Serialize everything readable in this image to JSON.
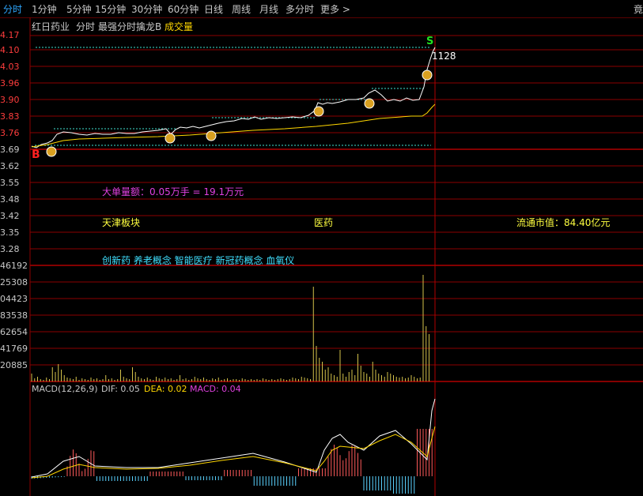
{
  "tabs": [
    {
      "label": "分时",
      "active": true
    },
    {
      "label": "1分钟"
    },
    {
      "label": "5分钟"
    },
    {
      "label": "15分钟"
    },
    {
      "label": "30分钟"
    },
    {
      "label": "60分钟"
    },
    {
      "label": "日线"
    },
    {
      "label": "周线"
    },
    {
      "label": "月线"
    },
    {
      "label": "多分时"
    },
    {
      "label": "更多 >"
    }
  ],
  "corner_label": "竟",
  "header": {
    "stock_name": "红日药业",
    "mode": "分时",
    "indicator": "最强分时擒龙B",
    "volume_label": "成交量"
  },
  "price_axis": {
    "labels": [
      "4.17",
      "4.10",
      "4.03",
      "3.96",
      "3.90",
      "3.83",
      "3.76",
      "3.69",
      "3.62",
      "3.55",
      "3.48",
      "3.42",
      "3.35",
      "3.28"
    ],
    "red_labels": [
      "4.17",
      "4.10",
      "4.03",
      "3.96",
      "3.90",
      "3.83",
      "3.76"
    ]
  },
  "volume_axis": {
    "labels": [
      "46192",
      "25308",
      "04423",
      "83538",
      "62654",
      "41769",
      "20885"
    ]
  },
  "markers": {
    "buy_label": "B",
    "sell_label": "S",
    "peak_label": "1128"
  },
  "info": {
    "big_order": "大单量额：0.05万手 = 19.1万元",
    "sector": "天津板块",
    "industry": "医药",
    "float_cap": "流通市值：84.40亿元",
    "concepts": "创新药 养老概念 智能医疗 新冠药概念 血氧仪"
  },
  "macd": {
    "label": "MACD(12,26,9)",
    "dif": "DIF: 0.05",
    "dea": "DEA: 0.02",
    "macd": "MACD: 0.04"
  },
  "colors": {
    "background": "#000000",
    "grid": "#8b0000",
    "price_line": "#ffffff",
    "avg_line": "#ffd700",
    "volume": "#d4c24a",
    "macd_up": "#ff5a5a",
    "macd_down": "#5ad2ff",
    "tab_active": "#2ea8ff",
    "info_magenta": "#e040e0",
    "info_yellow": "#ffff40",
    "info_cyan": "#40e0ff"
  }
}
